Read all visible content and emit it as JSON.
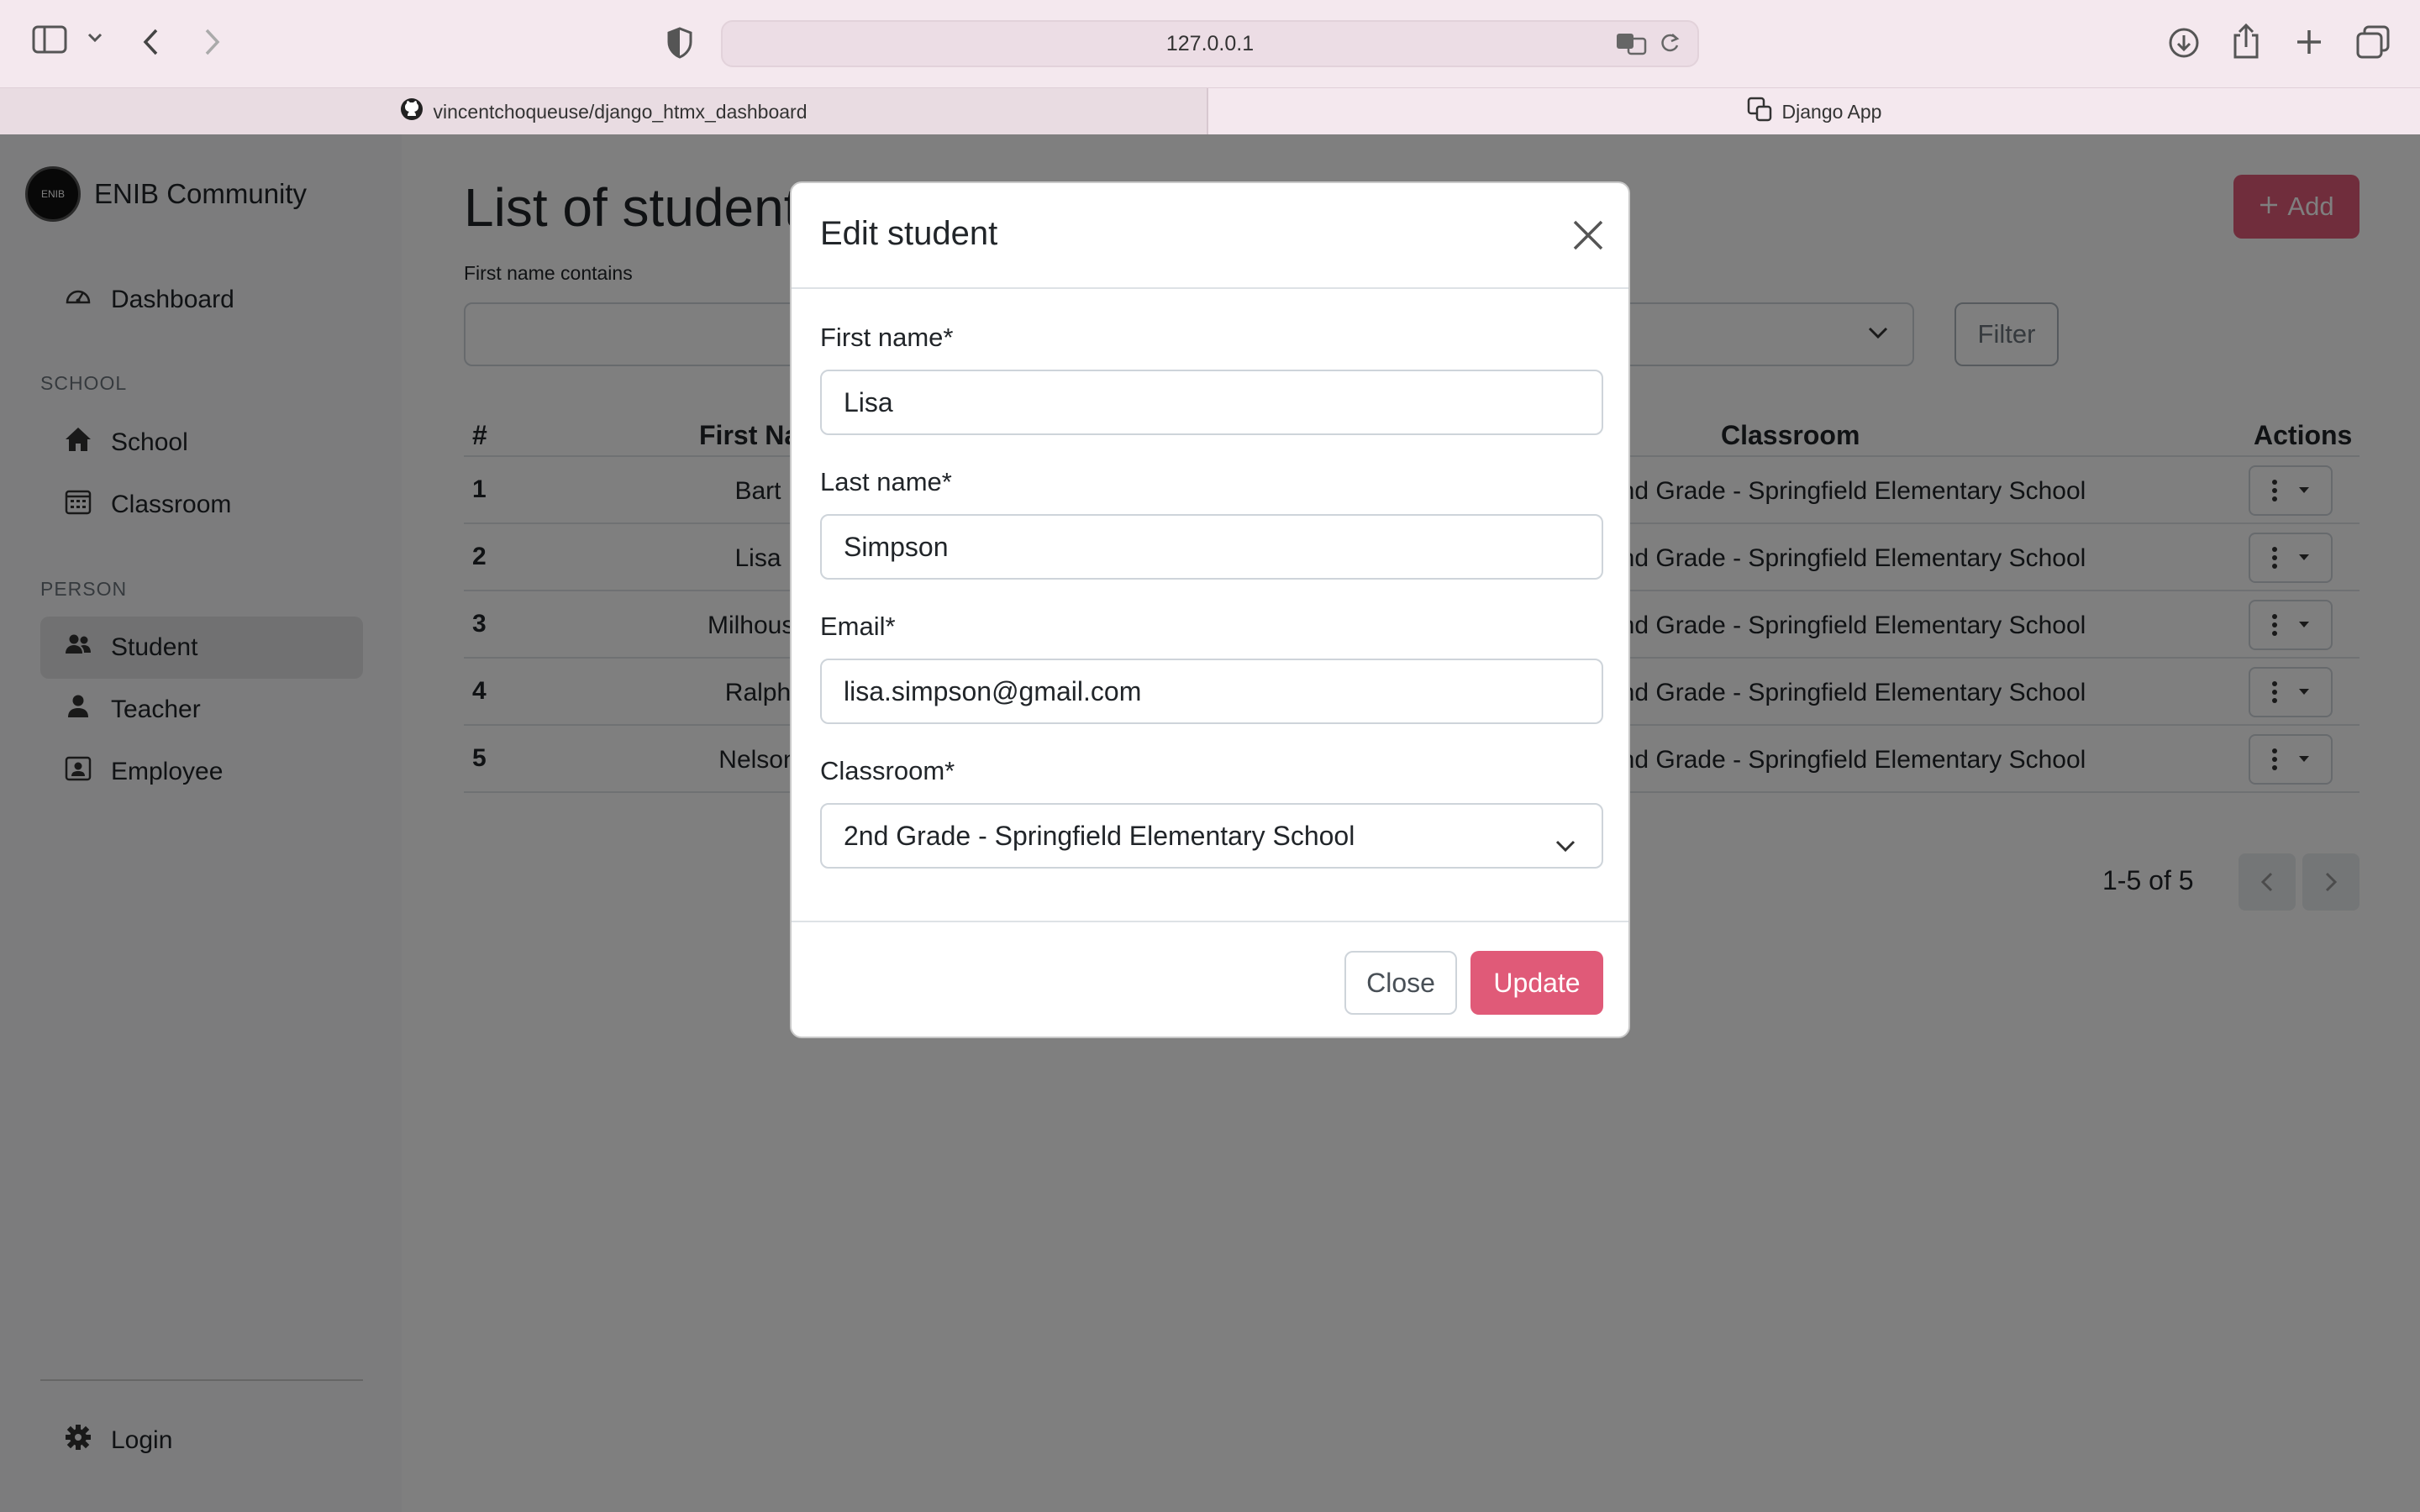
{
  "browser": {
    "url": "127.0.0.1",
    "tabs": [
      {
        "label": "vincentchoqueuse/django_htmx_dashboard"
      },
      {
        "label": "Django App"
      }
    ]
  },
  "sidebar": {
    "brand": "ENIB Community",
    "logo_text": "ENIB",
    "dashboard": "Dashboard",
    "school_section": "SCHOOL",
    "school": "School",
    "classroom": "Classroom",
    "person_section": "PERSON",
    "student": "Student",
    "teacher": "Teacher",
    "employee": "Employee",
    "login": "Login"
  },
  "main": {
    "title": "List of students",
    "add_label": "Add",
    "filter_label": "First name contains",
    "filter_button": "Filter",
    "columns": {
      "num": "#",
      "first_name": "First Name",
      "classroom": "Classroom",
      "actions": "Actions"
    },
    "rows": [
      {
        "num": "1",
        "first": "Bart",
        "classroom": "2nd Grade - Springfield Elementary School"
      },
      {
        "num": "2",
        "first": "Lisa",
        "classroom": "2nd Grade - Springfield Elementary School"
      },
      {
        "num": "3",
        "first": "Milhouse",
        "classroom": "2nd Grade - Springfield Elementary School"
      },
      {
        "num": "4",
        "first": "Ralph",
        "classroom": "2nd Grade - Springfield Elementary School"
      },
      {
        "num": "5",
        "first": "Nelson",
        "classroom": "2nd Grade - Springfield Elementary School"
      }
    ],
    "pagination": "1-5 of 5"
  },
  "modal": {
    "title": "Edit student",
    "first_name_label": "First name*",
    "first_name_value": "Lisa",
    "last_name_label": "Last name*",
    "last_name_value": "Simpson",
    "email_label": "Email*",
    "email_value": "lisa.simpson@gmail.com",
    "classroom_label": "Classroom*",
    "classroom_value": "2nd Grade - Springfield Elementary School",
    "close_label": "Close",
    "update_label": "Update"
  },
  "colors": {
    "accent": "#e05a78",
    "toolbar": "#f4e8ee"
  }
}
